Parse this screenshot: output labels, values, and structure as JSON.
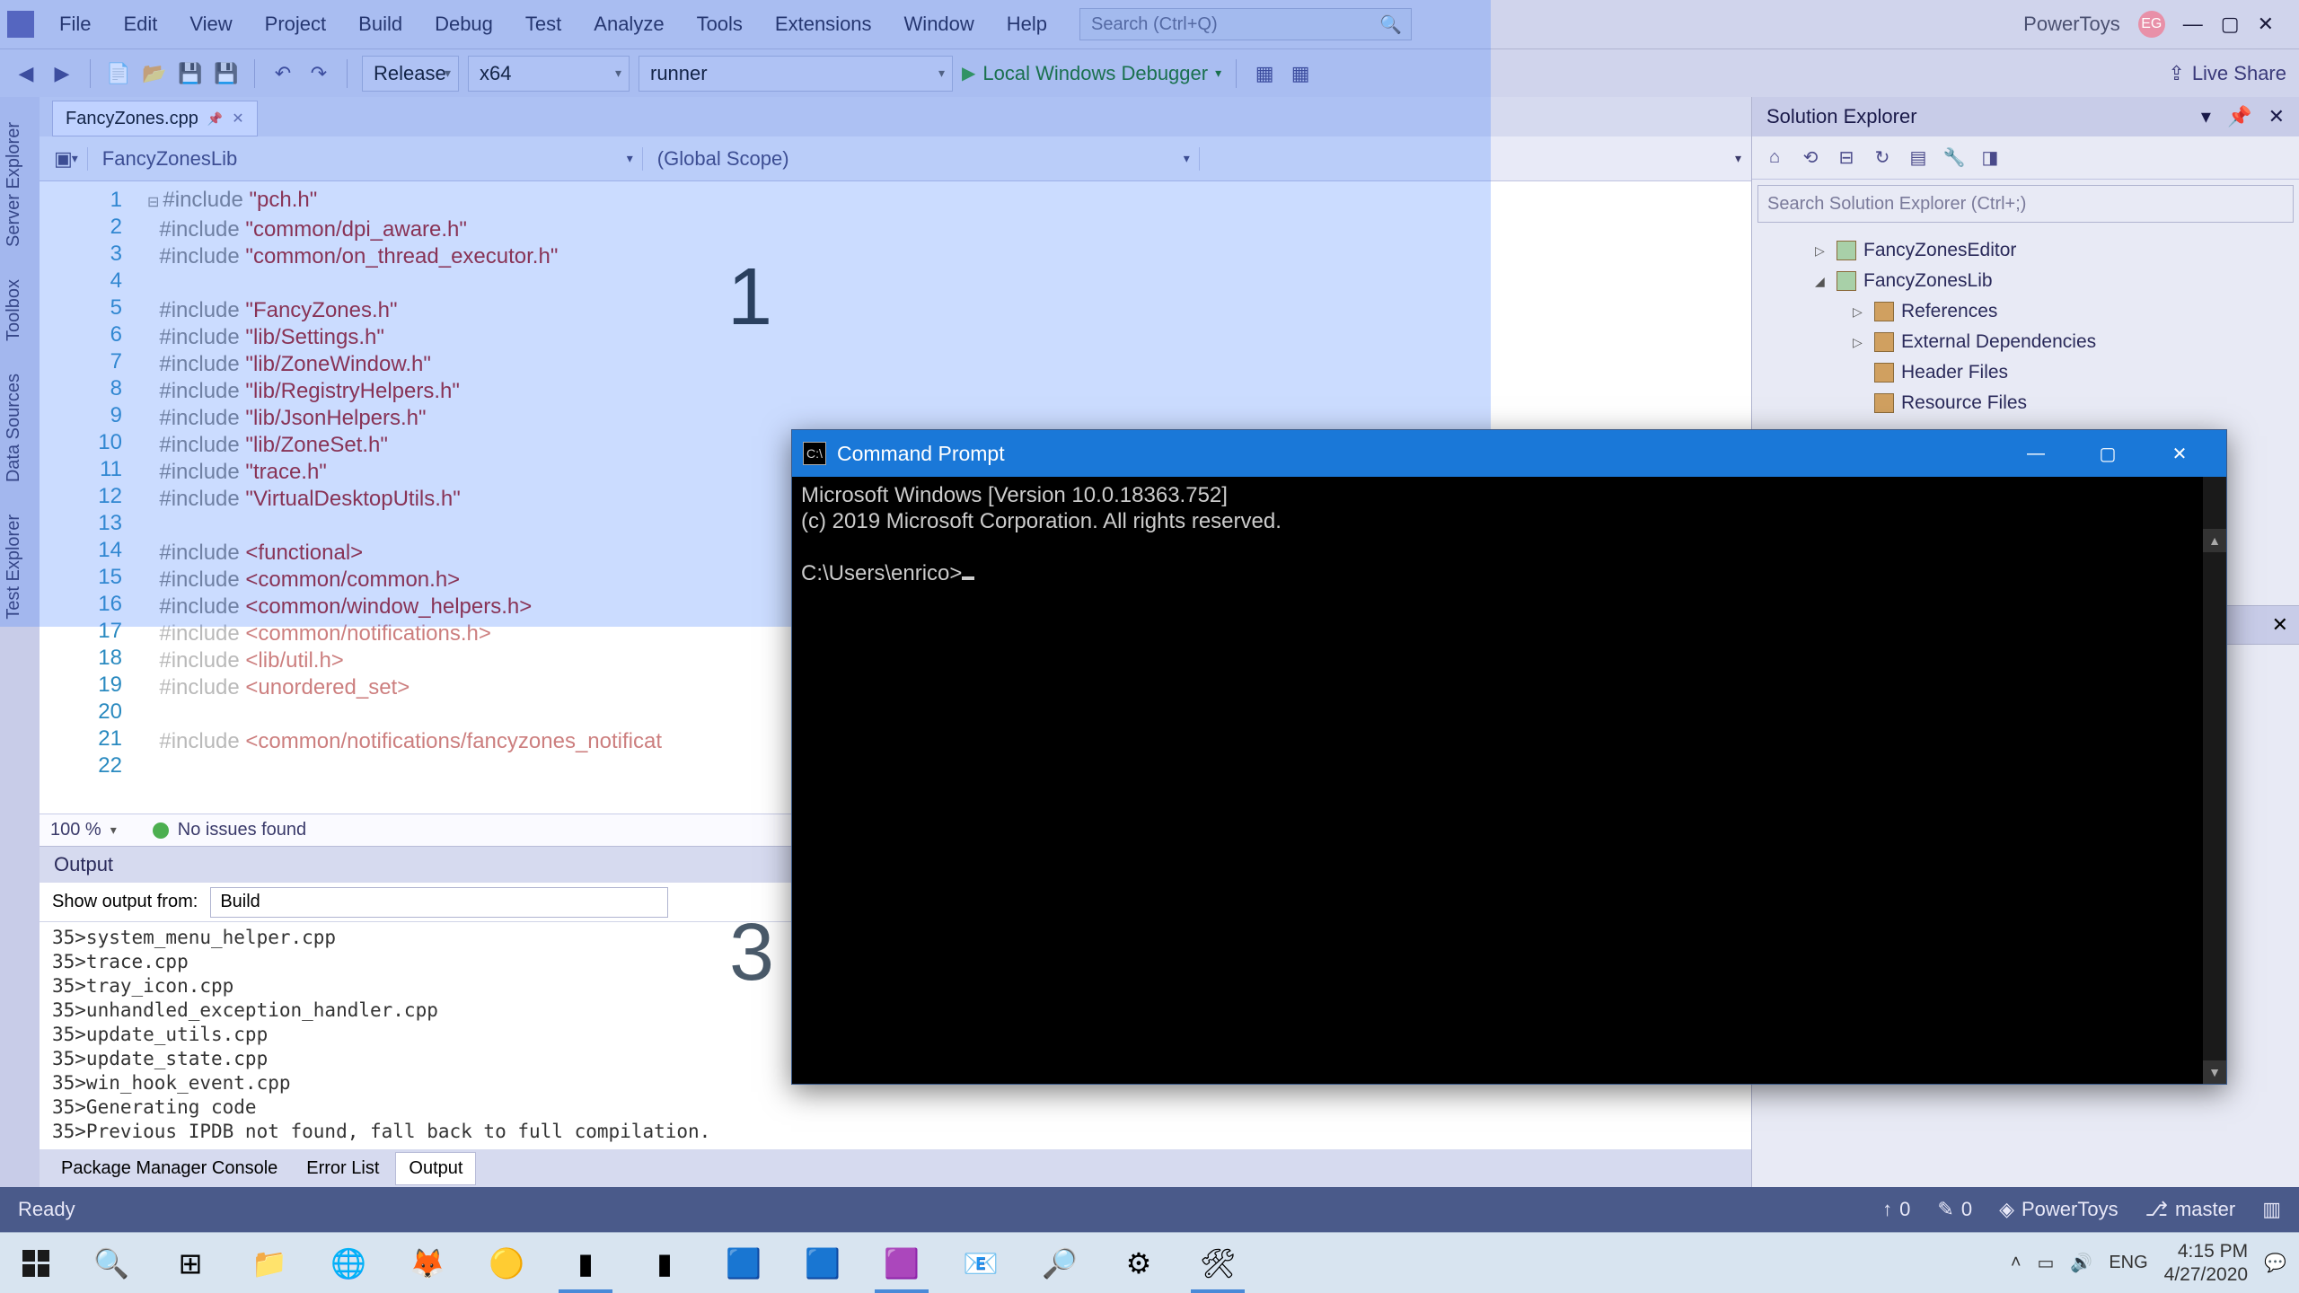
{
  "vs": {
    "menu": [
      "File",
      "Edit",
      "View",
      "Project",
      "Build",
      "Debug",
      "Test",
      "Analyze",
      "Tools",
      "Extensions",
      "Window",
      "Help"
    ],
    "search_placeholder": "Search (Ctrl+Q)",
    "title_app": "PowerToys",
    "user_initials": "EG",
    "config": "Release",
    "platform": "x64",
    "startup": "runner",
    "debugger": "Local Windows Debugger",
    "liveshare": "Live Share",
    "left_tabs": [
      "Server Explorer",
      "Toolbox",
      "Data Sources",
      "Test Explorer"
    ],
    "tab_name": "FancyZones.cpp",
    "context_project": "FancyZonesLib",
    "context_scope": "(Global Scope)",
    "code": [
      {
        "n": 1,
        "t": "#include \"pch.h\""
      },
      {
        "n": 2,
        "t": "#include \"common/dpi_aware.h\""
      },
      {
        "n": 3,
        "t": "#include \"common/on_thread_executor.h\""
      },
      {
        "n": 4,
        "t": ""
      },
      {
        "n": 5,
        "t": "#include \"FancyZones.h\""
      },
      {
        "n": 6,
        "t": "#include \"lib/Settings.h\""
      },
      {
        "n": 7,
        "t": "#include \"lib/ZoneWindow.h\""
      },
      {
        "n": 8,
        "t": "#include \"lib/RegistryHelpers.h\""
      },
      {
        "n": 9,
        "t": "#include \"lib/JsonHelpers.h\""
      },
      {
        "n": 10,
        "t": "#include \"lib/ZoneSet.h\""
      },
      {
        "n": 11,
        "t": "#include \"trace.h\""
      },
      {
        "n": 12,
        "t": "#include \"VirtualDesktopUtils.h\""
      },
      {
        "n": 13,
        "t": ""
      },
      {
        "n": 14,
        "t": "#include <functional>"
      },
      {
        "n": 15,
        "t": "#include <common/common.h>"
      },
      {
        "n": 16,
        "t": "#include <common/window_helpers.h>"
      },
      {
        "n": 17,
        "t": "#include <common/notifications.h>",
        "inactive": true
      },
      {
        "n": 18,
        "t": "#include <lib/util.h>",
        "inactive": true
      },
      {
        "n": 19,
        "t": "#include <unordered_set>",
        "inactive": true
      },
      {
        "n": 20,
        "t": "",
        "inactive": true
      },
      {
        "n": 21,
        "t": "#include <common/notifications/fancyzones_notificat",
        "inactive": true
      },
      {
        "n": 22,
        "t": "",
        "inactive": true
      }
    ],
    "zoom": "100 %",
    "issues": "No issues found",
    "output_title": "Output",
    "output_from_label": "Show output from:",
    "output_from": "Build",
    "output_lines": [
      "35>system_menu_helper.cpp",
      "35>trace.cpp",
      "35>tray_icon.cpp",
      "35>unhandled_exception_handler.cpp",
      "35>update_utils.cpp",
      "35>update_state.cpp",
      "35>win_hook_event.cpp",
      "35>Generating code",
      "35>Previous IPDB not found, fall back to full compilation."
    ],
    "bottom_tabs": [
      "Package Manager Console",
      "Error List",
      "Output"
    ],
    "bottom_active": "Output",
    "sol_explorer": "Solution Explorer",
    "sol_search": "Search Solution Explorer (Ctrl+;)",
    "tree": [
      {
        "l": 1,
        "exp": "▷",
        "label": "FancyZonesEditor",
        "proj": true
      },
      {
        "l": 1,
        "exp": "◢",
        "label": "FancyZonesLib",
        "proj": true
      },
      {
        "l": 2,
        "exp": "▷",
        "label": "References"
      },
      {
        "l": 2,
        "exp": "▷",
        "label": "External Dependencies"
      },
      {
        "l": 2,
        "exp": "",
        "label": "Header Files"
      },
      {
        "l": 2,
        "exp": "",
        "label": "Resource Files"
      }
    ],
    "status_ready": "Ready",
    "status_up": "0",
    "status_pen": "0",
    "status_repo": "PowerToys",
    "status_branch": "master"
  },
  "cmd": {
    "title": "Command Prompt",
    "line1": "Microsoft Windows [Version 10.0.18363.752]",
    "line2": "(c) 2019 Microsoft Corporation. All rights reserved.",
    "prompt": "C:\\Users\\enrico>"
  },
  "taskbar": {
    "lang": "ENG",
    "time": "4:15 PM",
    "date": "4/27/2020"
  },
  "zones": {
    "z1": "1",
    "z3": "3"
  }
}
